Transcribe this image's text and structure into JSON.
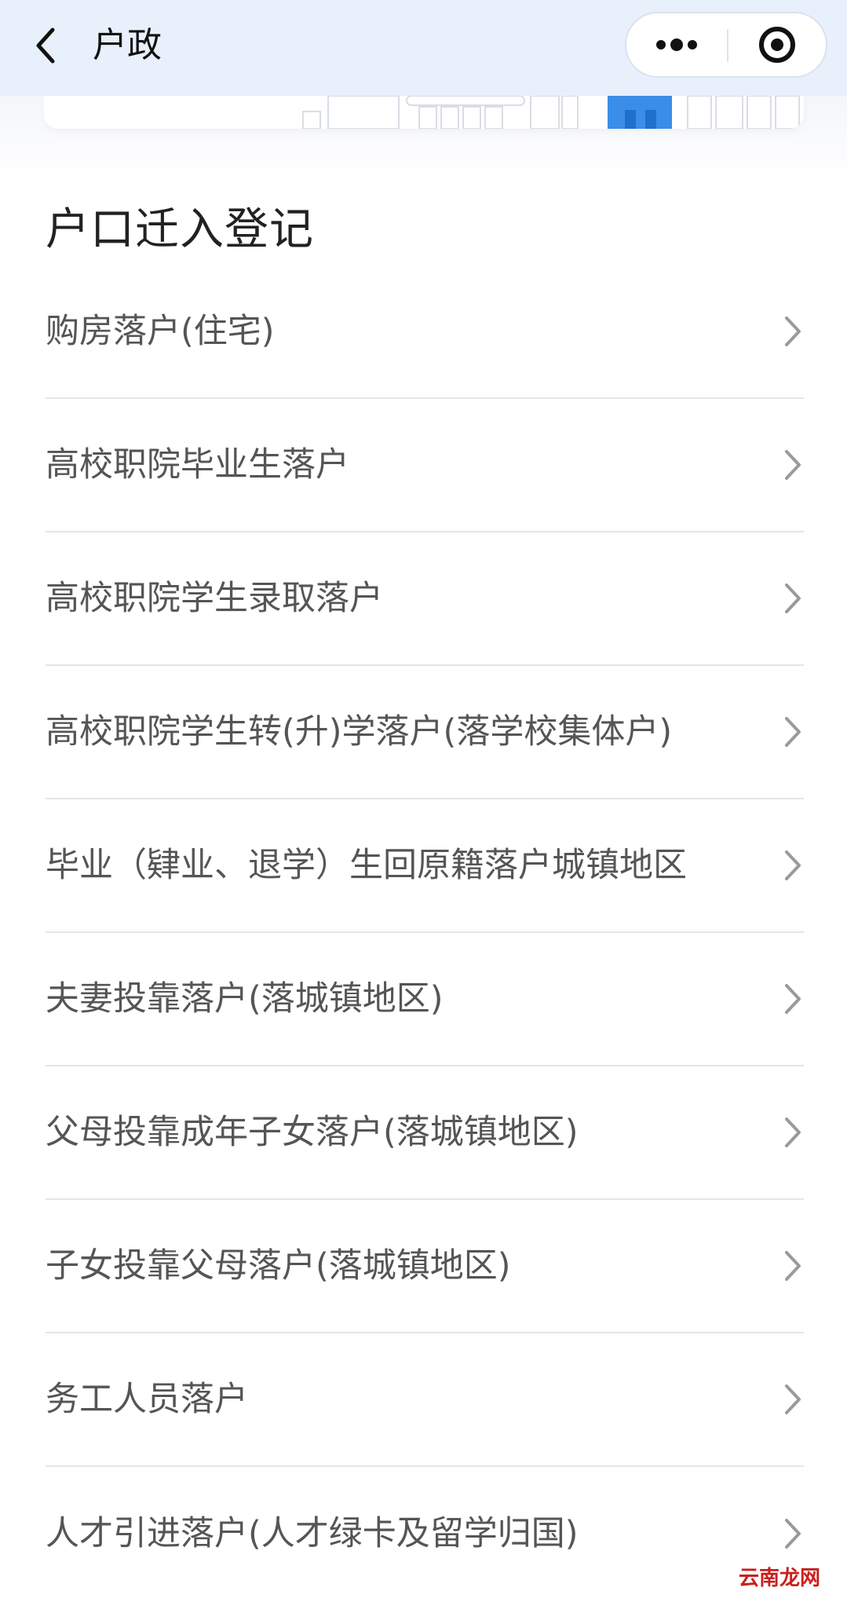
{
  "navbar": {
    "title": "户政",
    "back_icon": "chevron-left-icon",
    "more_icon": "more-dots-icon",
    "close_icon": "target-circle-icon"
  },
  "section": {
    "title": "户口迁入登记"
  },
  "items": [
    {
      "label": "购房落户(住宅)"
    },
    {
      "label": "高校职院毕业生落户"
    },
    {
      "label": "高校职院学生录取落户"
    },
    {
      "label": "高校职院学生转(升)学落户(落学校集体户)"
    },
    {
      "label": "毕业（肄业、退学）生回原籍落户城镇地区"
    },
    {
      "label": "夫妻投靠落户(落城镇地区)"
    },
    {
      "label": "父母投靠成年子女落户(落城镇地区)"
    },
    {
      "label": "子女投靠父母落户(落城镇地区)"
    },
    {
      "label": "务工人员落户"
    },
    {
      "label": "人才引进落户(人才绿卡及留学归国)"
    }
  ],
  "watermark": "云南龙网",
  "colors": {
    "navbar_bg": "#e8f0fb",
    "text_primary": "#222222",
    "text_item": "#555555",
    "divider": "#e6e6e6",
    "chevron": "#9a9a9a",
    "accent_blue": "#3a8ee8"
  }
}
